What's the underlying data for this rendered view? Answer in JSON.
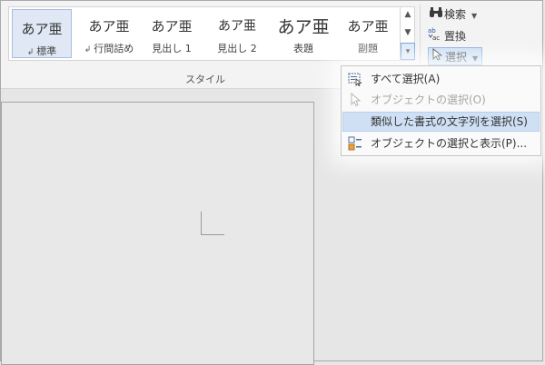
{
  "ribbon": {
    "styles": [
      {
        "sample": "あア亜",
        "name": "標準",
        "mark": "↲",
        "selected": true
      },
      {
        "sample": "あア亜",
        "name": "行間詰め",
        "mark": "↲"
      },
      {
        "sample": "あア亜",
        "name": "見出し 1"
      },
      {
        "sample": "あア亜",
        "name": "見出し 2"
      },
      {
        "sample": "あア亜",
        "name": "表題"
      },
      {
        "sample": "あア亜",
        "name": "副題"
      }
    ],
    "group_label": "スタイル",
    "editing": {
      "find": {
        "label": "検索",
        "icon": "binoculars-icon"
      },
      "replace": {
        "label": "置換",
        "icon": "replace-icon"
      },
      "select": {
        "label": "選択",
        "icon": "cursor-arrow-icon"
      }
    }
  },
  "select_menu": {
    "items": [
      {
        "label": "すべて選択(A)",
        "icon": "select-all-icon",
        "state": "normal"
      },
      {
        "label": "オブジェクトの選択(O)",
        "icon": "select-objects-icon",
        "state": "disabled"
      },
      {
        "label": "類似した書式の文字列を選択(S)",
        "icon": "",
        "state": "hover"
      },
      {
        "label": "オブジェクトの選択と表示(P)...",
        "icon": "selection-pane-icon",
        "state": "normal"
      }
    ]
  }
}
